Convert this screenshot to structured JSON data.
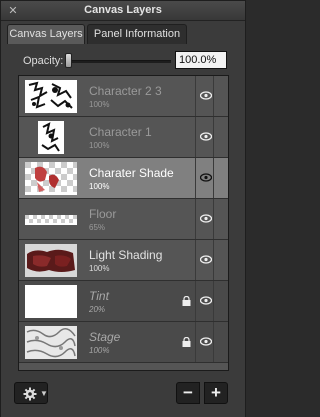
{
  "window": {
    "title": "Canvas Layers",
    "close_glyph": "✕"
  },
  "tabs": [
    {
      "label": "Canvas Layers"
    },
    {
      "label": "Panel Information"
    }
  ],
  "opacity": {
    "label": "Opacity:",
    "value": "100.0%",
    "level": 1.0
  },
  "layers": [
    {
      "name": "Character 2 3",
      "opacity": "100%",
      "locked": false,
      "visible": true
    },
    {
      "name": "Character 1",
      "opacity": "100%",
      "locked": false,
      "visible": true
    },
    {
      "name": "Charater Shade",
      "opacity": "100%",
      "locked": false,
      "visible": true,
      "selected": true
    },
    {
      "name": "Floor",
      "opacity": "65%",
      "locked": false,
      "visible": true
    },
    {
      "name": "Light Shading",
      "opacity": "100%",
      "locked": false,
      "visible": true
    },
    {
      "name": "Tint",
      "opacity": "20%",
      "locked": true,
      "visible": true
    },
    {
      "name": "Stage",
      "opacity": "100%",
      "locked": true,
      "visible": true
    }
  ],
  "bottom": {
    "minus_label": "−",
    "plus_label": "+"
  },
  "icons": {
    "gear": "gear-icon",
    "eye": "eye-icon",
    "lock": "lock-icon",
    "close": "close-icon"
  }
}
